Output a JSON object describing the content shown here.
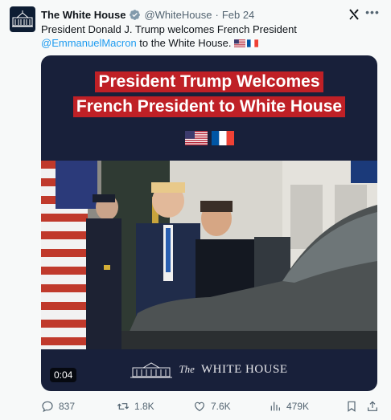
{
  "author": {
    "name": "The White House",
    "handle": "@WhiteHouse",
    "separator": "·",
    "date": "Feb 24"
  },
  "post": {
    "text_before": "President Donald J. Trump welcomes French President ",
    "mention": "@EmmanuelMacron",
    "text_after": " to the White House.",
    "inline_flags": [
      "us-flag",
      "france-flag"
    ]
  },
  "media": {
    "banner_line1": "President Trump Welcomes",
    "banner_line2": "French President to White House",
    "banner_color": "#bf2026",
    "flags": [
      "us-flag",
      "france-flag"
    ],
    "duration": "0:04",
    "footer_the": "The",
    "footer_white_house": "WHITE HOUSE"
  },
  "actions": {
    "replies": "837",
    "reposts": "1.8K",
    "likes": "7.6K",
    "views": "479K"
  },
  "icons": [
    "verified-badge-icon",
    "grok-icon",
    "more-icon",
    "reply-icon",
    "repost-icon",
    "like-icon",
    "views-icon",
    "bookmark-icon",
    "share-icon"
  ],
  "colors": {
    "link": "#1d9bf0",
    "muted": "#536471",
    "verified": "#829aab",
    "media_bg": "#18203a"
  }
}
